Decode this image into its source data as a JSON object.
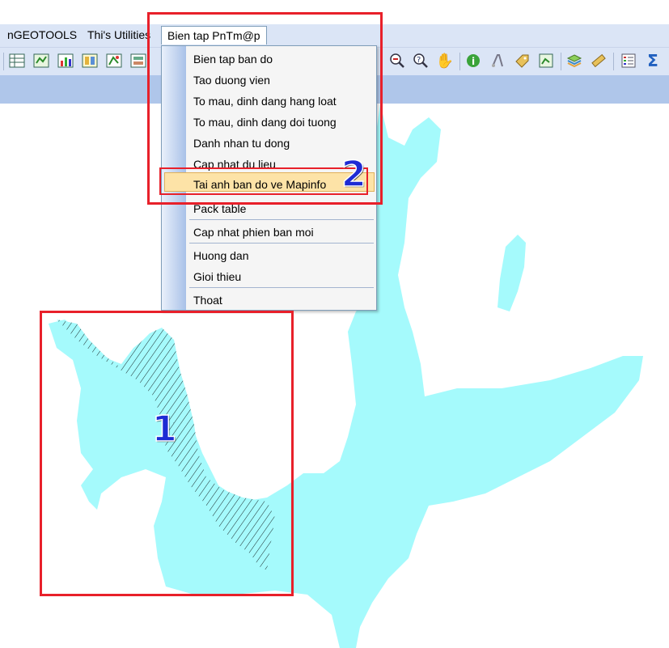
{
  "menubar": {
    "items": [
      {
        "label": "nGEOTOOLS"
      },
      {
        "label": "Thi's Utilities"
      },
      {
        "label": "Bien tap PnTm@p"
      }
    ]
  },
  "dropdown": {
    "items": [
      {
        "label": "Bien tap ban do"
      },
      {
        "label": "Tao duong vien"
      },
      {
        "label": "To mau, dinh dang hang loat"
      },
      {
        "label": "To mau, dinh dang doi tuong"
      },
      {
        "label": "Danh nhan tu dong"
      },
      {
        "label": "Cap nhat du lieu"
      },
      {
        "label": "Tai anh ban do ve Mapinfo",
        "highlighted": true
      },
      {
        "label": "Pack table"
      },
      {
        "label": "Cap nhat phien ban moi"
      },
      {
        "label": "Huong dan"
      },
      {
        "label": "Gioi thieu"
      },
      {
        "label": "Thoat"
      }
    ]
  },
  "annotations": {
    "step1": "1",
    "step2": "2"
  },
  "toolbar": {
    "left_icons": [
      "browse-table-icon",
      "map-window-icon",
      "graph-icon",
      "layout-icon",
      "redistrict-icon",
      "layer-control-icon"
    ],
    "right_icons": [
      "zoom-out-icon",
      "help-icon",
      "grabber-hand-icon",
      "info-icon",
      "ruler-icon",
      "label-icon",
      "hotlink-icon",
      "layers-icon",
      "measure-icon",
      "legend-icon",
      "sum-icon"
    ]
  },
  "colors": {
    "map_fill": "#a5fafc",
    "annotation_red": "#e8202a",
    "annotation_blue": "#1e2bd4",
    "menu_highlight": "#fde3a7"
  }
}
